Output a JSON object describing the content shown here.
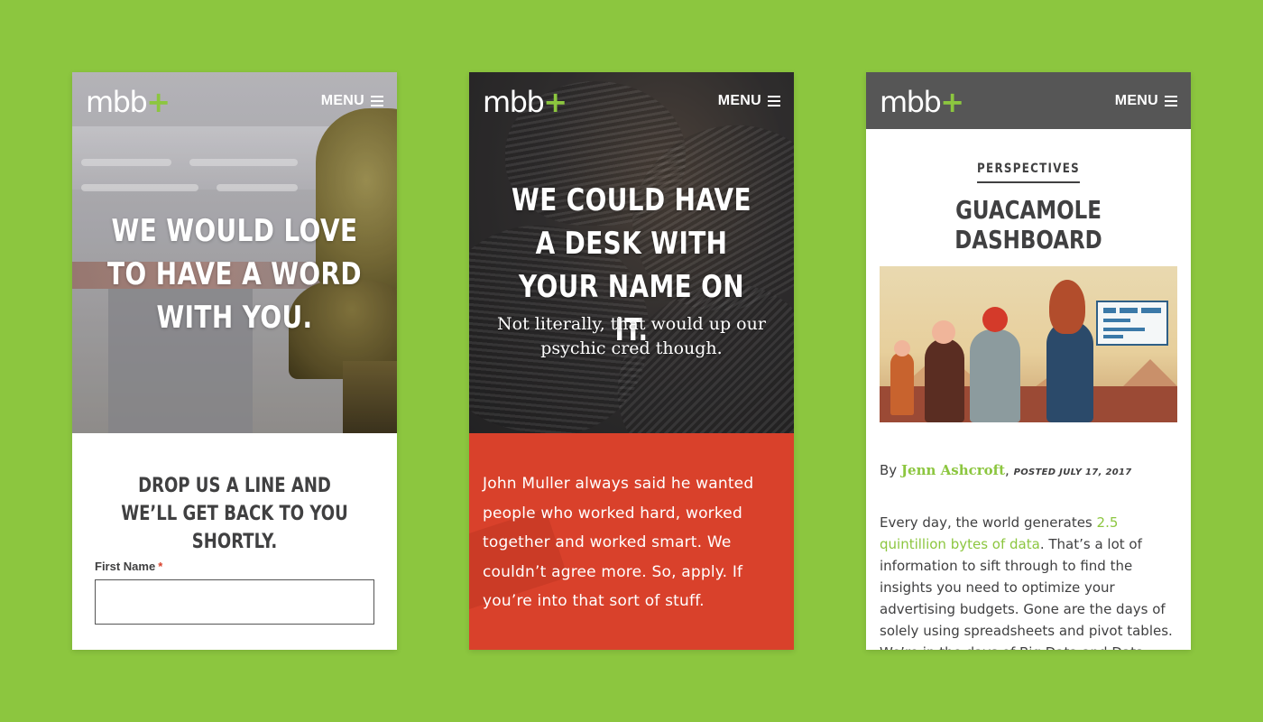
{
  "brand": {
    "logo_text": "mbb",
    "logo_plus": "+",
    "menu_label": "MENU",
    "accent": "#8cc63f",
    "background": "#8cc63f"
  },
  "contact_screen": {
    "hero_title": "WE WOULD LOVE TO HAVE A WORD WITH YOU.",
    "form_heading": "DROP US A LINE AND WE’LL GET BACK TO YOU SHORTLY.",
    "first_name_label": "First Name",
    "required_marker": "*",
    "first_name_value": ""
  },
  "careers_screen": {
    "hero_title": "WE COULD HAVE A DESK WITH YOUR NAME ON IT.",
    "hero_subtitle": "Not literally, that would up our psychic cred though.",
    "body": "John Muller always said he wanted people who worked hard, worked together and worked smart. We couldn’t agree more. So, apply. If you’re into that sort of stuff.",
    "accent": "#d9412b"
  },
  "article_screen": {
    "category": "PERSPECTIVES",
    "title": "GUACAMOLE DASHBOARD",
    "by_label": "By",
    "author": "Jenn Ashcroft",
    "byline_separator": ",",
    "posted": "POSTED JULY 17, 2017",
    "body_intro": "Every day, the world generates",
    "body_link": "2.5 quintillion bytes of data",
    "body_rest": ". That’s a lot of information to sift through to find the insights you need to optimize your advertising budgets. Gone are the days of solely using spreadsheets and pivot tables. We’re in the days of Big Data and Data Visualization. However, I’ll outline and",
    "header_color": "#565656"
  }
}
